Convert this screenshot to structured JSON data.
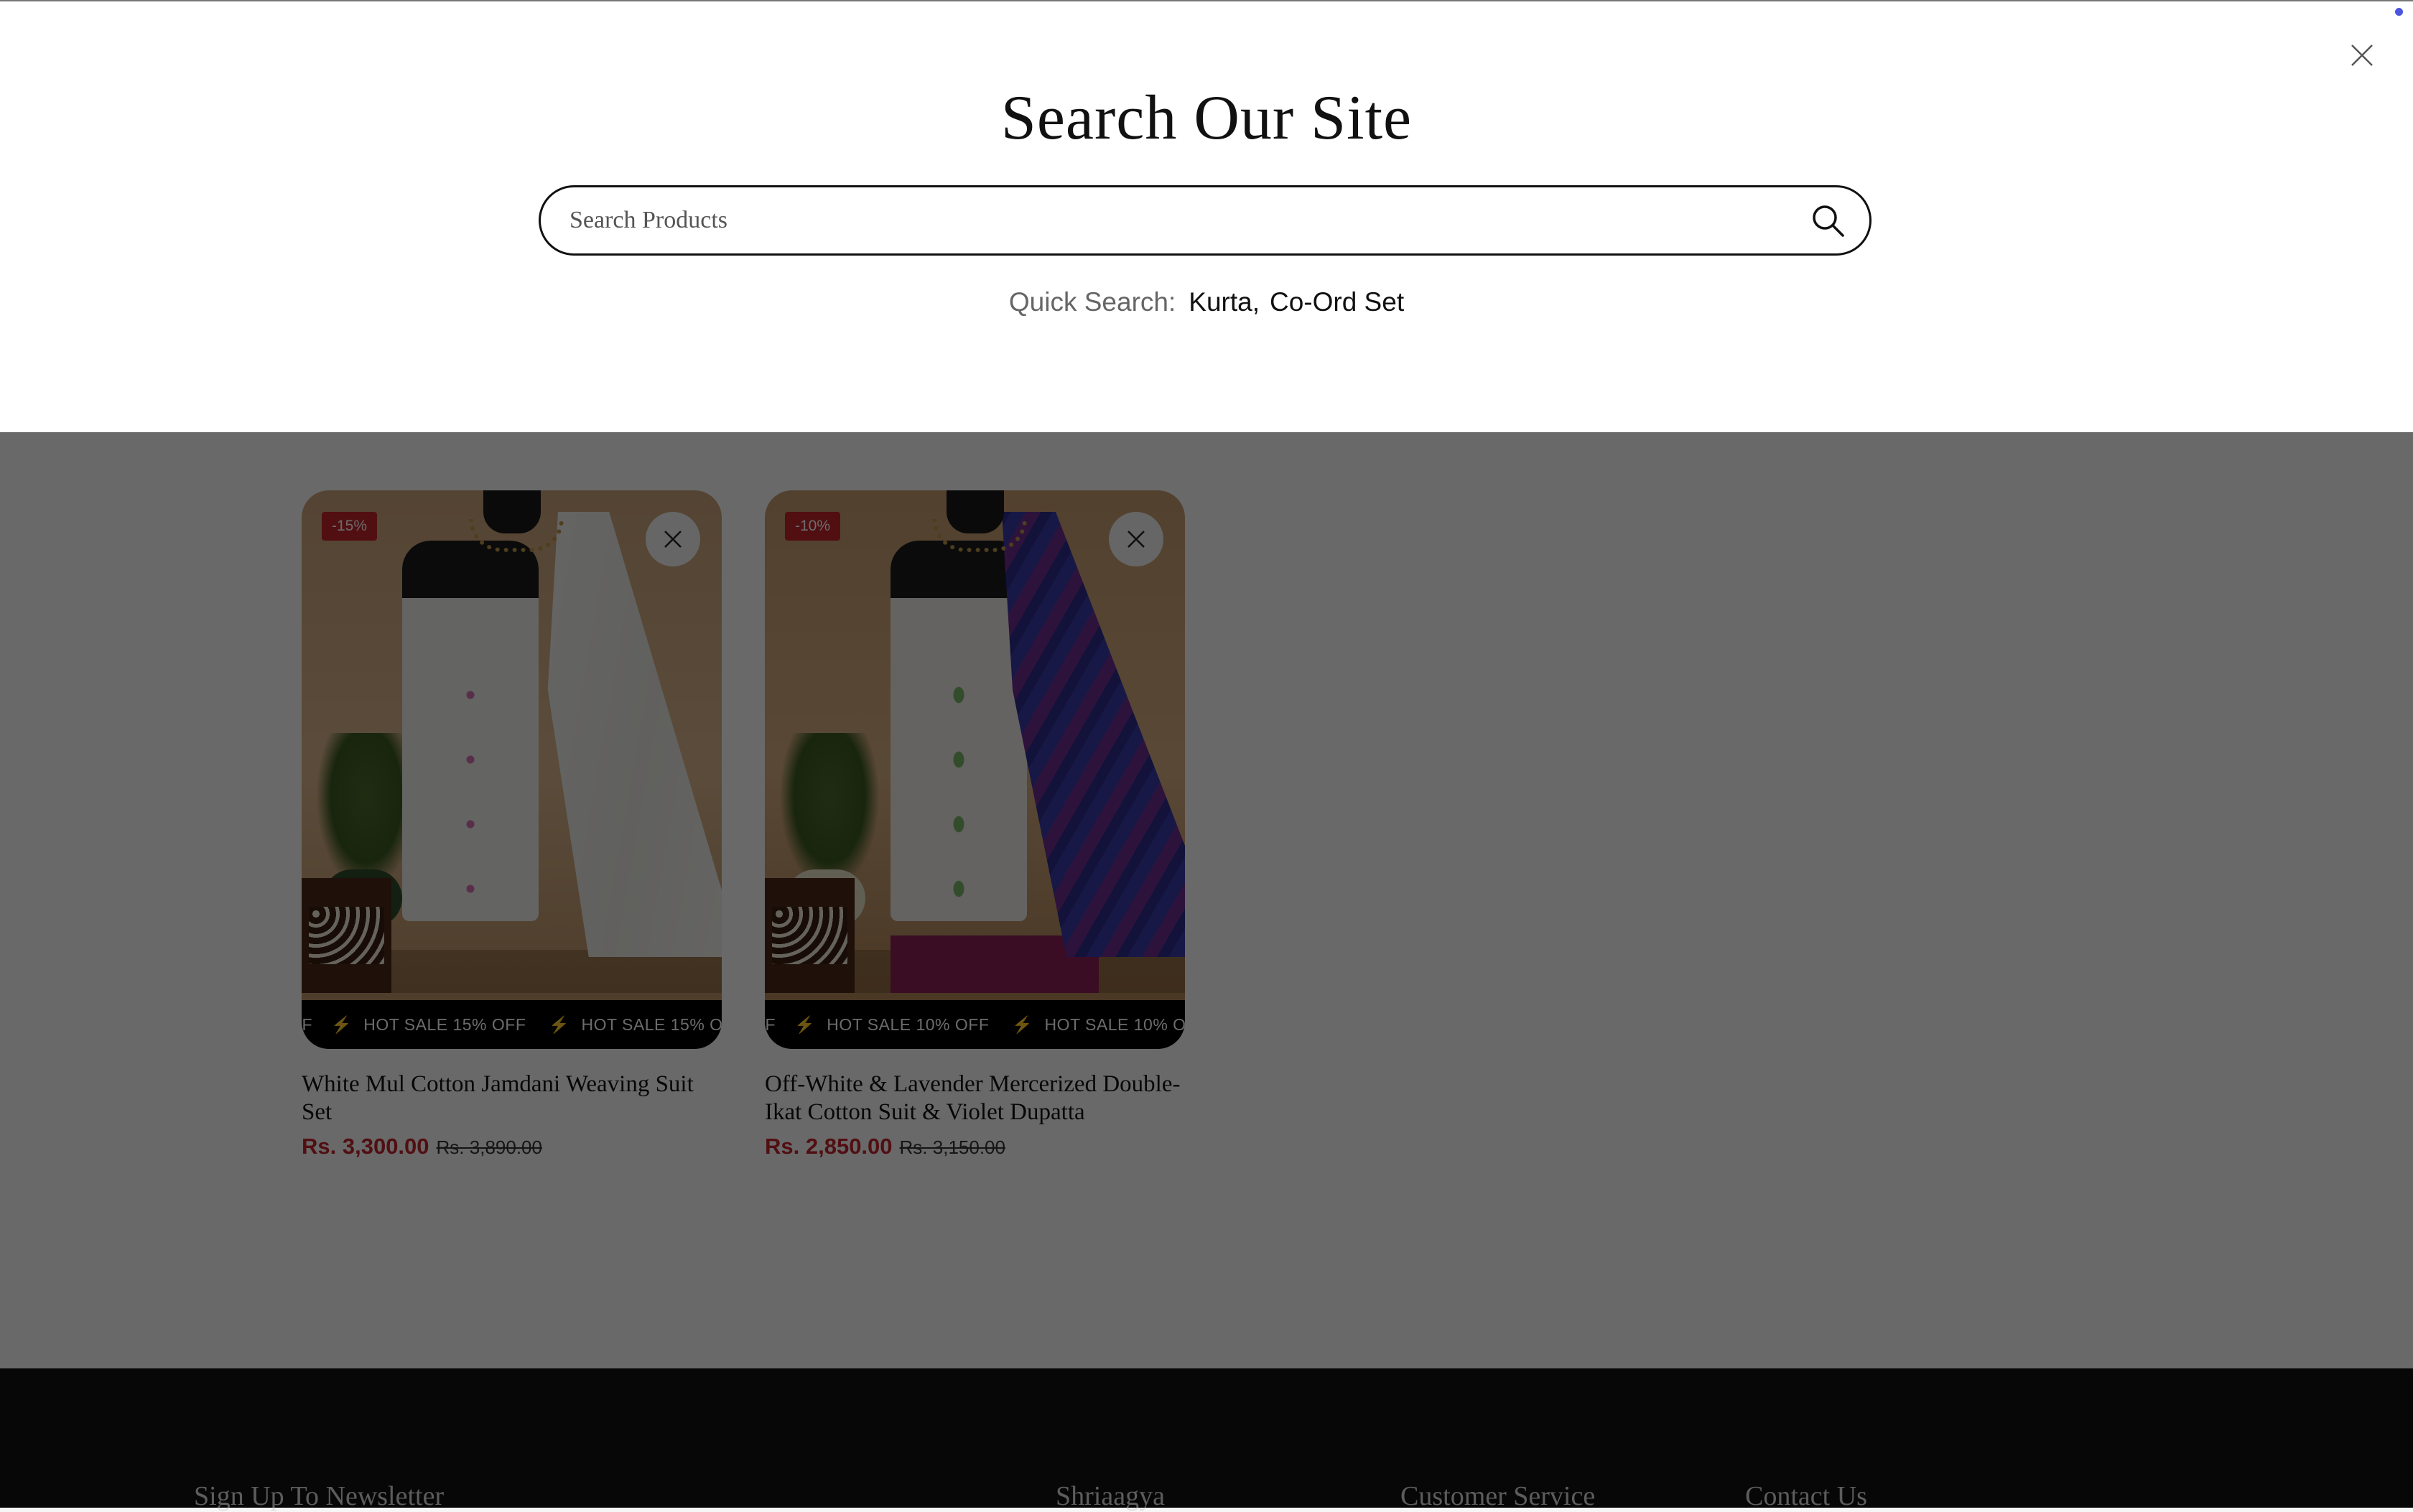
{
  "search_drawer": {
    "title": "Search Our Site",
    "search_placeholder": "Search Products",
    "quick_search_label": "Quick Search:",
    "quick_links": [
      "Kurta",
      "Co-Ord Set"
    ]
  },
  "products": [
    {
      "discount_badge": "-15%",
      "marquee_lead": "FF",
      "marquee_text": "HOT SALE 15% OFF",
      "title": "White Mul Cotton Jamdani Weaving Suit Set",
      "price": "Rs. 3,300.00",
      "compare_price": "Rs. 3,890.00"
    },
    {
      "discount_badge": "-10%",
      "marquee_lead": "FF",
      "marquee_text": "HOT SALE 10% OFF",
      "title": "Off-White & Lavender Mercerized Double-Ikat Cotton Suit & Violet Dupatta",
      "price": "Rs. 2,850.00",
      "compare_price": "Rs. 3,150.00"
    }
  ],
  "footer": {
    "newsletter_heading": "Sign Up To Newsletter",
    "brand_heading": "Shriaagya",
    "customer_service_heading": "Customer Service",
    "contact_heading": "Contact Us"
  },
  "colors": {
    "accent_price": "#c0252c",
    "badge_bg": "#c0252c",
    "notification_dot": "#4b55e0"
  }
}
